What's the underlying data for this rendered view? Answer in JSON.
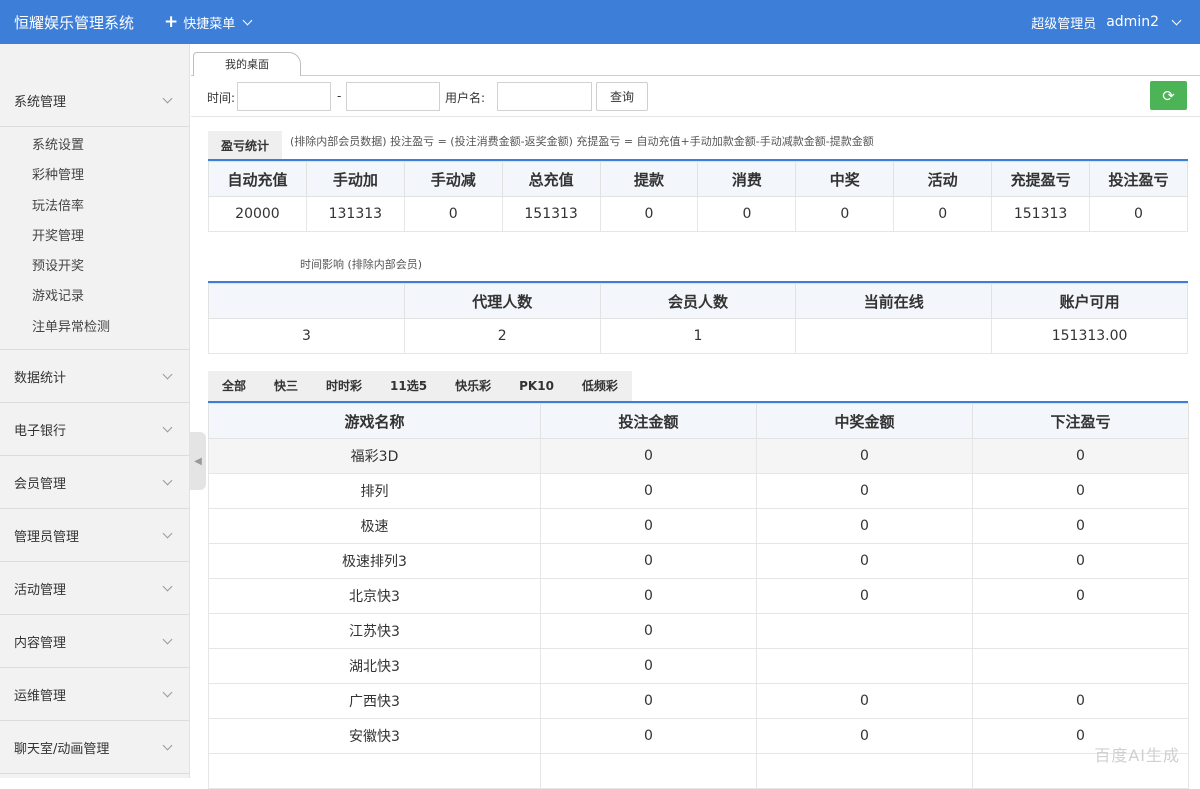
{
  "header": {
    "brand": "恒耀娱乐管理系统",
    "quick_menu": "快捷菜单",
    "role": "超级管理员",
    "username": "admin2"
  },
  "sidebar": {
    "groups": [
      {
        "label": "系统管理",
        "items": [
          "系统设置",
          "彩种管理",
          "玩法倍率",
          "开奖管理",
          "预设开奖",
          "游戏记录",
          "注单异常检测"
        ]
      },
      {
        "label": "数据统计"
      },
      {
        "label": "电子银行"
      },
      {
        "label": "会员管理"
      },
      {
        "label": "管理员管理"
      },
      {
        "label": "活动管理"
      },
      {
        "label": "内容管理"
      },
      {
        "label": "运维管理"
      },
      {
        "label": "聊天室/动画管理"
      }
    ]
  },
  "tabs": [
    "我的桌面"
  ],
  "filter": {
    "time_label": "时间:",
    "dash": "-",
    "user_label": "用户名:",
    "query_button": "查询"
  },
  "profit": {
    "title": "盈亏统计",
    "note": "(排除内部会员数据)  投注盈亏 = (投注消费金额-返奖金额)    充提盈亏 = 自动充值+手动加款金额-手动减款金额-提款金额",
    "columns": [
      "自动充值",
      "手动加",
      "手动减",
      "总充值",
      "提款",
      "消费",
      "中奖",
      "活动",
      "充提盈亏",
      "投注盈亏"
    ],
    "row": [
      "20000",
      "131313",
      "0",
      "151313",
      "0",
      "0",
      "0",
      "0",
      "151313",
      "0"
    ]
  },
  "members": {
    "note": "时间影响 (排除内部会员)",
    "columns": [
      "",
      "代理人数",
      "会员人数",
      "当前在线",
      "账户可用"
    ],
    "row": [
      "3",
      "2",
      "1",
      "",
      "151313.00"
    ]
  },
  "games": {
    "tabs": [
      "全部",
      "快三",
      "时时彩",
      "11选5",
      "快乐彩",
      "PK10",
      "低频彩"
    ],
    "columns": [
      "游戏名称",
      "投注金额",
      "中奖金额",
      "下注盈亏"
    ],
    "rows": [
      [
        "福彩3D",
        "0",
        "0",
        "0"
      ],
      [
        "排列",
        "0",
        "0",
        "0"
      ],
      [
        "极速",
        "0",
        "0",
        "0"
      ],
      [
        "极速排列3",
        "0",
        "0",
        "0"
      ],
      [
        "北京快3",
        "0",
        "0",
        "0"
      ],
      [
        "江苏快3",
        "0",
        "",
        ""
      ],
      [
        "湖北快3",
        "0",
        "",
        ""
      ],
      [
        "广西快3",
        "0",
        "0",
        "0"
      ],
      [
        "安徽快3",
        "0",
        "0",
        "0"
      ],
      [
        "",
        "",
        "",
        ""
      ]
    ]
  },
  "colors": {
    "primary": "#3c7ed8",
    "refresh": "#4cb356"
  },
  "watermark": "百度AI生成"
}
